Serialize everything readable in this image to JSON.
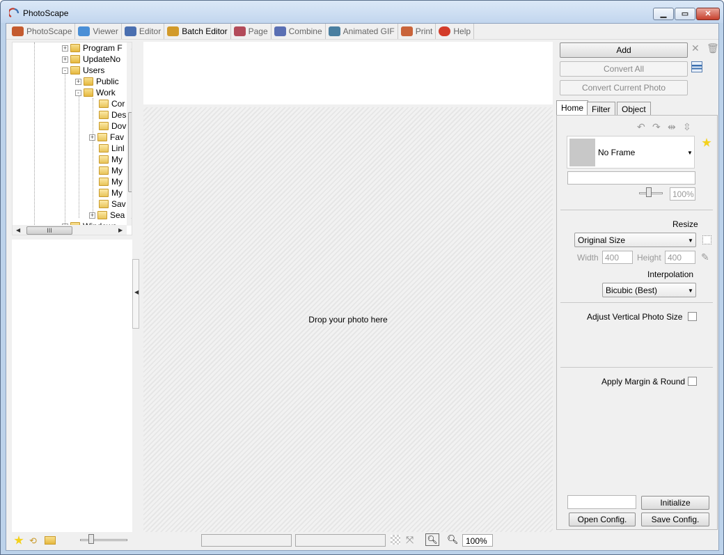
{
  "window": {
    "title": "PhotoScape"
  },
  "tabs": [
    {
      "label": "PhotoScape",
      "color": "#c45b2f"
    },
    {
      "label": "Viewer",
      "color": "#4a8fd6"
    },
    {
      "label": "Editor",
      "color": "#4a6fb0"
    },
    {
      "label": "Batch Editor",
      "color": "#d29a2a",
      "active": true
    },
    {
      "label": "Page",
      "color": "#b34b5a"
    },
    {
      "label": "Combine",
      "color": "#5a6fb3"
    },
    {
      "label": "Animated GIF",
      "color": "#4a7fa0"
    },
    {
      "label": "Print",
      "color": "#c9643a"
    },
    {
      "label": "Help",
      "color": "#d33c2a"
    }
  ],
  "tree": {
    "items": [
      {
        "label": "Program F",
        "expander": "+"
      },
      {
        "label": "UpdateNo",
        "expander": "+"
      },
      {
        "label": "Users",
        "expander": "-"
      },
      {
        "label": "Public",
        "expander": "+"
      },
      {
        "label": "Work",
        "expander": "-"
      },
      {
        "label": "Cor",
        "expander": ""
      },
      {
        "label": "Des",
        "expander": ""
      },
      {
        "label": "Dov",
        "expander": ""
      },
      {
        "label": "Fav",
        "expander": "+"
      },
      {
        "label": "Linl",
        "expander": ""
      },
      {
        "label": "My",
        "expander": ""
      },
      {
        "label": "My",
        "expander": ""
      },
      {
        "label": "My",
        "expander": ""
      },
      {
        "label": "My",
        "expander": ""
      },
      {
        "label": "Sav",
        "expander": ""
      },
      {
        "label": "Sea",
        "expander": "+"
      },
      {
        "label": "Windows",
        "expander": "+"
      }
    ],
    "hscroll_grip": "III"
  },
  "drop": {
    "text": "Drop your photo here"
  },
  "bottom": {
    "zoom": "100%"
  },
  "right": {
    "add": "Add",
    "convert_all": "Convert All",
    "convert_current": "Convert Current Photo",
    "tabs": [
      "Home",
      "Filter",
      "Object"
    ],
    "frame": {
      "selected": "No Frame",
      "opacity": "100%"
    },
    "resize": {
      "title": "Resize",
      "mode": "Original Size",
      "width_label": "Width",
      "width": "400",
      "height_label": "Height",
      "height": "400",
      "interp_label": "Interpolation",
      "interp": "Bicubic (Best)"
    },
    "adjust_vertical": "Adjust Vertical Photo Size",
    "apply_margin": "Apply Margin & Round",
    "initialize": "Initialize",
    "open_config": "Open Config.",
    "save_config": "Save Config."
  }
}
